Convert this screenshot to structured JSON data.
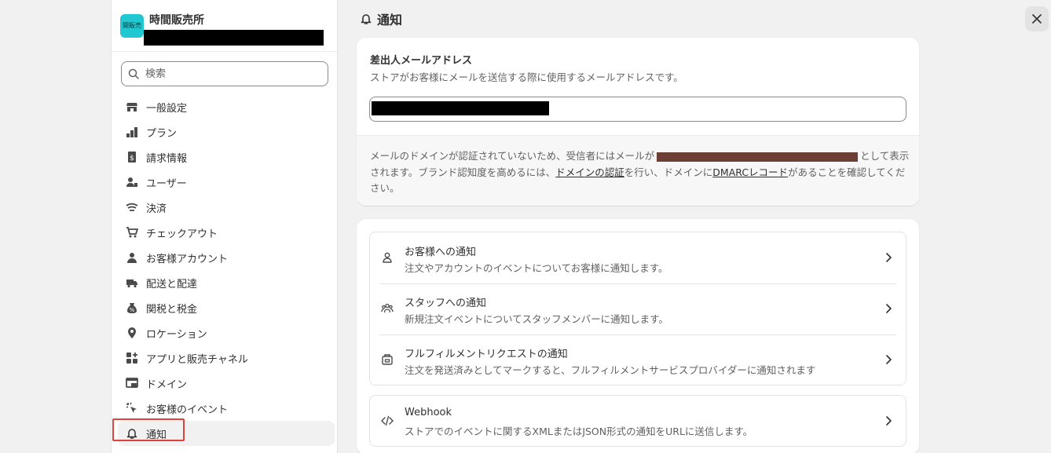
{
  "store": {
    "logo_text": "間販売",
    "name": "時間販売所"
  },
  "search": {
    "placeholder": "検索"
  },
  "nav": [
    {
      "label": "一般設定",
      "icon": "store-icon"
    },
    {
      "label": "プラン",
      "icon": "plan-icon"
    },
    {
      "label": "請求情報",
      "icon": "billing-icon"
    },
    {
      "label": "ユーザー",
      "icon": "users-icon"
    },
    {
      "label": "決済",
      "icon": "payments-icon"
    },
    {
      "label": "チェックアウト",
      "icon": "cart-icon"
    },
    {
      "label": "お客様アカウント",
      "icon": "person-icon"
    },
    {
      "label": "配送と配達",
      "icon": "truck-icon"
    },
    {
      "label": "関税と税金",
      "icon": "tax-icon"
    },
    {
      "label": "ロケーション",
      "icon": "location-icon"
    },
    {
      "label": "アプリと販売チャネル",
      "icon": "apps-icon"
    },
    {
      "label": "ドメイン",
      "icon": "domain-icon"
    },
    {
      "label": "お客様のイベント",
      "icon": "cursor-icon"
    },
    {
      "label": "通知",
      "icon": "bell-icon",
      "active": true
    }
  ],
  "page": {
    "title": "通知"
  },
  "sender": {
    "title": "差出人メールアドレス",
    "description": "ストアがお客様にメールを送信する際に使用するメールアドレスです。",
    "note": {
      "part1": "メールのドメインが認証されていないため、受信者にはメールが",
      "part2": "として表示されます。ブランド認知度を高めるには、",
      "link_domain": "ドメインの認証",
      "part3": "を行い、ドメインに",
      "link_dmarc": "DMARCレコード",
      "part4": "があることを確認してください。"
    }
  },
  "notifications": [
    {
      "title": "お客様への通知",
      "description": "注文やアカウントのイベントについてお客様に通知します。",
      "icon": "person-icon"
    },
    {
      "title": "スタッフへの通知",
      "description": "新規注文イベントについてスタッフメンバーに通知します。",
      "icon": "staff-icon"
    },
    {
      "title": "フルフィルメントリクエストの通知",
      "description": "注文を発送済みとしてマークすると、フルフィルメントサービスプロバイダーに通知されます",
      "icon": "fulfillment-icon"
    }
  ],
  "webhook": {
    "title": "Webhook",
    "description": "ストアでのイベントに関するXMLまたはJSON形式の通知をURLに送信します。",
    "icon": "code-icon"
  },
  "colors": {
    "accent_highlight": "#e0413b",
    "logo_bg": "#21c7d1"
  }
}
